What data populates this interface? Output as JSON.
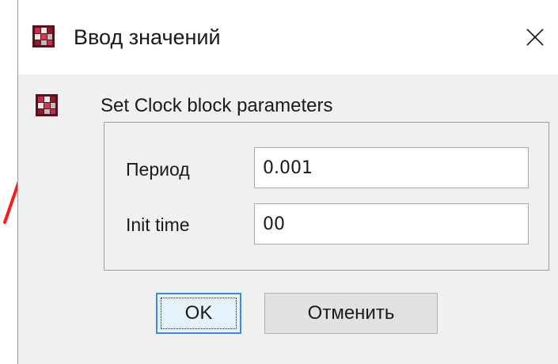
{
  "window": {
    "title": "Ввод значений"
  },
  "dialog": {
    "heading": "Set Clock block parameters",
    "fields": [
      {
        "label": "Период",
        "value": "0.001"
      },
      {
        "label": "Init time",
        "value": "00"
      }
    ]
  },
  "buttons": {
    "ok_label": "OK",
    "cancel_label": "Отменить"
  },
  "colors": {
    "dialog_background": "#f0f0f0",
    "titlebar_background": "#ffffff",
    "ok_border": "#3a8be0",
    "ok_fill": "#e5f1fb",
    "annotation_stroke": "#ff1a1a"
  },
  "icons": {
    "app": "scilab-app-icon",
    "close": "close-icon"
  }
}
